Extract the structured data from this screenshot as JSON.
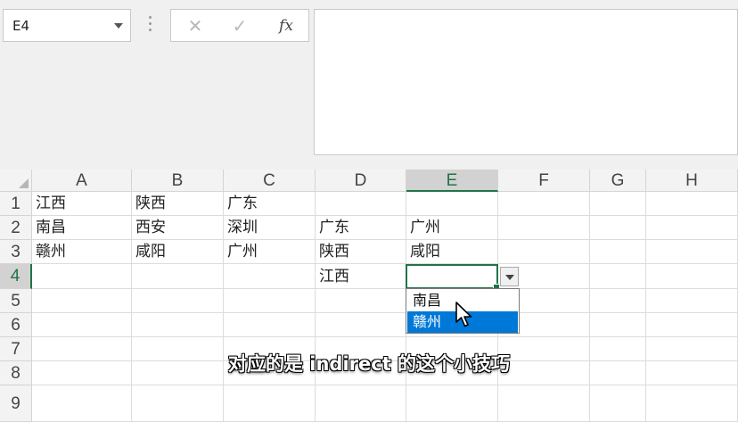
{
  "name_box": {
    "value": "E4"
  },
  "formula_bar": {
    "cancel_glyph": "✕",
    "enter_glyph": "✓",
    "fx_label": "fx",
    "value": ""
  },
  "columns": [
    "A",
    "B",
    "C",
    "D",
    "E",
    "F",
    "G",
    "H"
  ],
  "rows": [
    "1",
    "2",
    "3",
    "4",
    "5",
    "6",
    "7",
    "8",
    "9"
  ],
  "selected": {
    "column": "E",
    "row": "4"
  },
  "cells": {
    "A1": "江西",
    "B1": "陕西",
    "C1": "广东",
    "A2": "南昌",
    "B2": "西安",
    "C2": "深圳",
    "D2": "广东",
    "E2": "广州",
    "A3": "赣州",
    "B3": "咸阳",
    "C3": "广州",
    "D3": "陕西",
    "E3": "咸阳",
    "D4": "江西"
  },
  "dropdown": {
    "options": [
      "南昌",
      "赣州"
    ],
    "highlighted_index": 1
  },
  "caption": "对应的是 indirect 的这个小技巧",
  "colors": {
    "accent_green": "#217346",
    "highlight_blue": "#0078d7"
  },
  "icons": {
    "cancel": "cancel-icon",
    "enter": "enter-icon",
    "function": "fx-icon",
    "dropdown": "chevron-down-icon",
    "cursor": "mouse-pointer-icon"
  }
}
